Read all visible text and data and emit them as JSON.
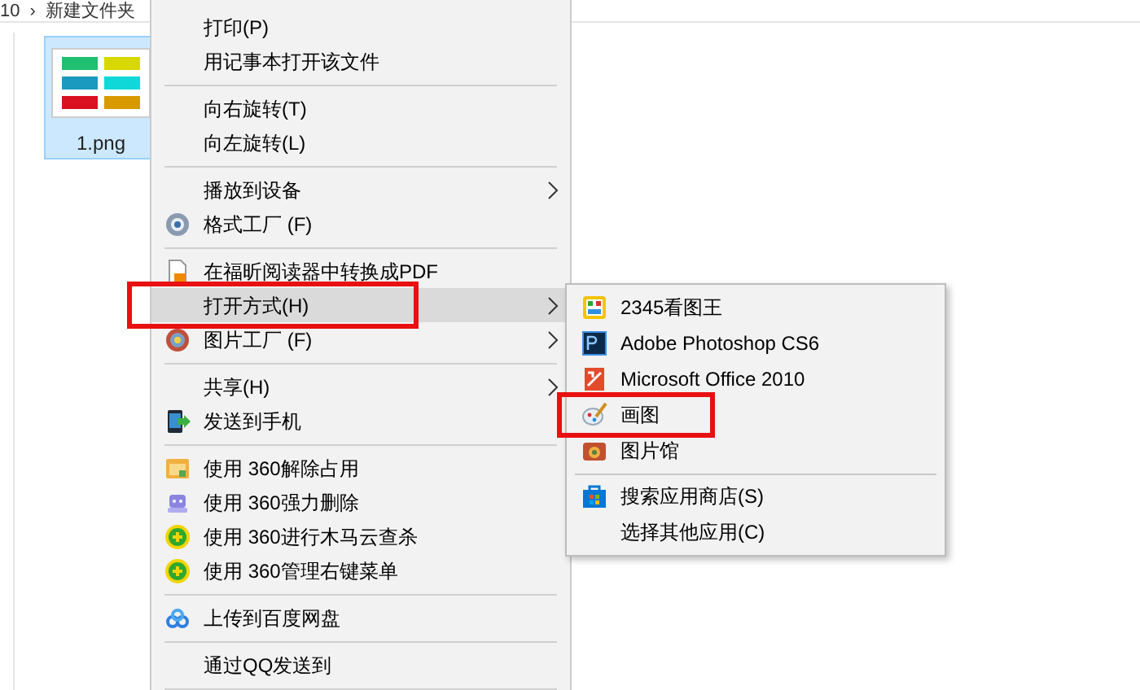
{
  "breadcrumb": [
    {
      "label": "10"
    },
    {
      "label": "›"
    },
    {
      "label": "新建文件夹"
    }
  ],
  "file": {
    "name": "1.png",
    "selected": true
  },
  "context_menu": [
    {
      "kind": "item",
      "label": "打印(P)",
      "has_submenu": false,
      "selected": false,
      "annotated": false
    },
    {
      "kind": "item",
      "label": "用记事本打开该文件",
      "has_submenu": false,
      "selected": false,
      "annotated": false
    },
    {
      "kind": "separator"
    },
    {
      "kind": "item",
      "label": "向右旋转(T)",
      "has_submenu": false,
      "selected": false,
      "annotated": false
    },
    {
      "kind": "item",
      "label": "向左旋转(L)",
      "has_submenu": false,
      "selected": false,
      "annotated": false
    },
    {
      "kind": "separator"
    },
    {
      "kind": "item",
      "label": "播放到设备",
      "has_submenu": true,
      "selected": false,
      "annotated": false
    },
    {
      "kind": "item",
      "label": "格式工厂 (F)",
      "has_submenu": false,
      "selected": false,
      "annotated": false
    },
    {
      "kind": "separator"
    },
    {
      "kind": "item",
      "label": "在福昕阅读器中转换成PDF",
      "has_submenu": false,
      "selected": false,
      "annotated": false
    },
    {
      "kind": "item",
      "label": "打开方式(H)",
      "has_submenu": true,
      "selected": true,
      "annotated": true
    },
    {
      "kind": "item",
      "label": "图片工厂 (F)",
      "has_submenu": true,
      "selected": false,
      "annotated": false
    },
    {
      "kind": "separator"
    },
    {
      "kind": "item",
      "label": "共享(H)",
      "has_submenu": true,
      "selected": false,
      "annotated": false
    },
    {
      "kind": "item",
      "label": "发送到手机",
      "has_submenu": false,
      "selected": false,
      "annotated": false
    },
    {
      "kind": "separator"
    },
    {
      "kind": "item",
      "label": "使用 360解除占用",
      "has_submenu": false,
      "selected": false,
      "annotated": false
    },
    {
      "kind": "item",
      "label": "使用 360强力删除",
      "has_submenu": false,
      "selected": false,
      "annotated": false
    },
    {
      "kind": "item",
      "label": "使用 360进行木马云查杀",
      "has_submenu": false,
      "selected": false,
      "annotated": false
    },
    {
      "kind": "item",
      "label": "使用 360管理右键菜单",
      "has_submenu": false,
      "selected": false,
      "annotated": false
    },
    {
      "kind": "separator"
    },
    {
      "kind": "item",
      "label": "上传到百度网盘",
      "has_submenu": false,
      "selected": false,
      "annotated": false
    },
    {
      "kind": "separator"
    },
    {
      "kind": "item",
      "label": "通过QQ发送到",
      "has_submenu": false,
      "selected": false,
      "annotated": false
    },
    {
      "kind": "separator"
    }
  ],
  "open_with_menu": [
    {
      "kind": "item",
      "label": "2345看图王",
      "selected": false,
      "annotated": false
    },
    {
      "kind": "item",
      "label": "Adobe Photoshop CS6",
      "selected": false,
      "annotated": false
    },
    {
      "kind": "item",
      "label": "Microsoft Office 2010",
      "selected": false,
      "annotated": false
    },
    {
      "kind": "item",
      "label": "画图",
      "selected": false,
      "annotated": true
    },
    {
      "kind": "item",
      "label": "图片馆",
      "selected": false,
      "annotated": false
    },
    {
      "kind": "separator"
    },
    {
      "kind": "item",
      "label": "搜索应用商店(S)",
      "selected": false,
      "annotated": false
    },
    {
      "kind": "item",
      "label": "选择其他应用(C)",
      "selected": false,
      "annotated": false
    }
  ]
}
